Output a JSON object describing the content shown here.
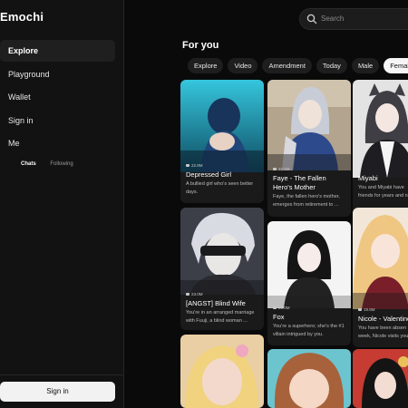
{
  "app": {
    "brand": "Emochi"
  },
  "sidebar": {
    "items": [
      {
        "label": "Explore",
        "active": true
      },
      {
        "label": "Playground"
      },
      {
        "label": "Wallet"
      },
      {
        "label": "Sign in"
      },
      {
        "label": "Me"
      }
    ],
    "subtabs": [
      "Chats",
      "Following"
    ],
    "signin_button": "Sign in"
  },
  "search": {
    "placeholder": "Search"
  },
  "main": {
    "section_title": "For you",
    "filters": [
      "Explore",
      "Video",
      "Amendment",
      "Today",
      "Male",
      "Female"
    ],
    "active_filter": "Female",
    "cards": [
      {
        "count": "22.8M",
        "title": "Depressed Girl",
        "desc": "A bullied girl who's seen better days."
      },
      {
        "count": "22.5M",
        "title": "Faye - The Fallen Hero's Mother",
        "desc": "Faye, the fallen hero's mother, emerges from retirement to ..."
      },
      {
        "count": "",
        "title": "Miyabi",
        "desc": "You and Miyabi have friends for years and n"
      },
      {
        "count": "23.0M",
        "title": "[ANGST] Blind Wife",
        "desc": "You're in an arranged marriage with Fuuji, a blind woman ..."
      },
      {
        "count": "23.0M",
        "title": "Fox",
        "desc": "You're a superhero; she's the #1 villain intrigued by you."
      },
      {
        "count": "19.8M",
        "title": "Nicole - Valentine",
        "desc": "You have been absen week, Nicole visits you"
      }
    ]
  },
  "colors": {
    "background": "#0a0a0a",
    "sidebar": "#121212",
    "accent": "#f5f5f5"
  }
}
